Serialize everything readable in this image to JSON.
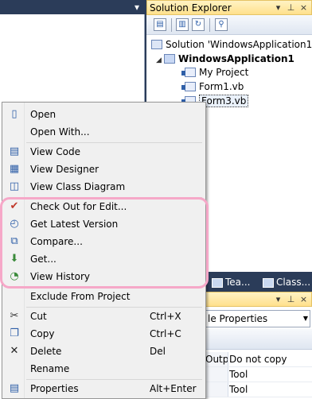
{
  "editor": {
    "pin_icon": "pin-icon"
  },
  "solution_explorer": {
    "title": "Solution Explorer",
    "title_buttons": [
      "▾",
      "⊥",
      "×"
    ],
    "tree": [
      {
        "label": "Solution 'WindowsApplication1'",
        "icon": "solution-icon"
      },
      {
        "label": "WindowsApplication1",
        "icon": "project-icon"
      },
      {
        "label": "My Project",
        "icon": "my-project-icon"
      },
      {
        "label": "Form1.vb",
        "icon": "form-file-icon"
      },
      {
        "label": "Form3.vb",
        "icon": "form-file-icon"
      }
    ]
  },
  "bottom_tabs": [
    {
      "label": "Tea...",
      "icon": "team-explorer-icon"
    },
    {
      "label": "Class...",
      "icon": "class-view-icon"
    }
  ],
  "properties": {
    "title_buttons": [
      "▾",
      "⊥",
      "×"
    ],
    "selected_object": "le Properties",
    "rows": [
      {
        "key": "Outp",
        "value": "Do not copy"
      },
      {
        "key": "",
        "value": "Tool"
      },
      {
        "key": "",
        "value": "Tool"
      }
    ]
  },
  "context_menu": {
    "items": [
      {
        "label": "Open",
        "icon": "open-file-icon"
      },
      {
        "label": "Open With...",
        "icon": ""
      },
      {
        "label": "View Code",
        "icon": "view-code-icon"
      },
      {
        "label": "View Designer",
        "icon": "view-designer-icon"
      },
      {
        "label": "View Class Diagram",
        "icon": "class-diagram-icon"
      },
      {
        "label": "Check Out for Edit...",
        "icon": "checkmark-icon"
      },
      {
        "label": "Get Latest Version",
        "icon": "get-latest-icon"
      },
      {
        "label": "Compare...",
        "icon": "compare-icon"
      },
      {
        "label": "Get...",
        "icon": "get-icon"
      },
      {
        "label": "View History",
        "icon": "history-icon"
      },
      {
        "label": "Exclude From Project",
        "icon": ""
      },
      {
        "label": "Cut",
        "icon": "scissors-icon",
        "shortcut": "Ctrl+X"
      },
      {
        "label": "Copy",
        "icon": "copy-icon",
        "shortcut": "Ctrl+C"
      },
      {
        "label": "Delete",
        "icon": "delete-x-icon",
        "shortcut": "Del"
      },
      {
        "label": "Rename",
        "icon": ""
      },
      {
        "label": "Properties",
        "icon": "properties-icon",
        "shortcut": "Alt+Enter"
      }
    ]
  },
  "colors": {
    "dark_background": "#2b3c59",
    "title_gradient_top": "#fff3c4",
    "title_gradient_bottom": "#ffe08c",
    "highlight_pink": "#f6a8c8"
  }
}
